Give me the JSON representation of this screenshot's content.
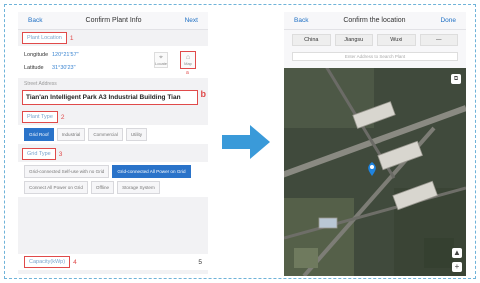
{
  "left_screen": {
    "nav": {
      "back": "Back",
      "title": "Confirm Plant Info",
      "next": "Next"
    },
    "plant_location": {
      "label": "Plant Location",
      "marker": "1"
    },
    "longitude": {
      "label": "Longitude",
      "value": "120°21'57\""
    },
    "latitude": {
      "label": "Latitude",
      "value": "31°30'23\""
    },
    "locate_button": "Locate",
    "map_button": "Map",
    "map_marker": "a",
    "street_address_label": "Street Address",
    "address": {
      "value": "Tian'an Intelligent Park A3 Industrial Building Tian",
      "marker": "b"
    },
    "plant_type": {
      "label": "Plant Type",
      "marker": "2",
      "options": [
        "Grid Roof",
        "Industrial",
        "Commercial",
        "Utility"
      ],
      "selected": 0
    },
    "grid_type": {
      "label": "Grid Type",
      "marker": "3",
      "options": [
        "Grid-connected Self-use with no Grid",
        "Grid-connected All Power on Grid",
        "Connect All Power on Grid",
        "Offline",
        "Storage System"
      ],
      "selected": 1
    },
    "capacity": {
      "label": "Capacity(kWp)",
      "marker": "4",
      "value": "5"
    }
  },
  "right_screen": {
    "nav": {
      "back": "Back",
      "title": "Confirm the location",
      "done": "Done"
    },
    "location_selects": [
      "China",
      "Jiangsu",
      "Wuxi",
      "—"
    ],
    "search_placeholder": "Enter Address to Search Plant",
    "zoom_in": "+",
    "compass": "▲"
  },
  "colors": {
    "accent": "#2a73c9",
    "highlight": "#e04a4a",
    "arrow": "#3a9ad9"
  }
}
